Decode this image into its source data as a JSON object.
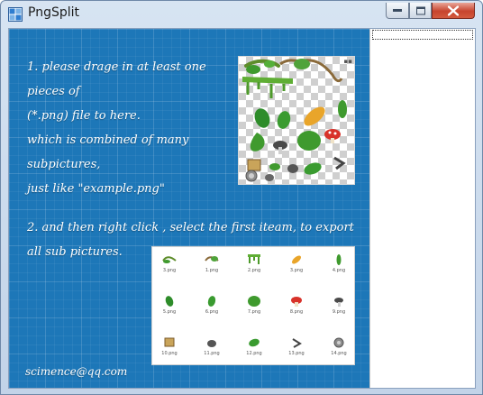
{
  "window": {
    "title": "PngSplit"
  },
  "instructions": {
    "step1_lines": [
      "1.  please drage in at least one pieces of",
      "(*.png) file to here.",
      "which is combined of many subpictures,",
      "just like \"example.png\""
    ],
    "step2_lines": [
      "2. and then right click , select the first iteam, to export",
      "all sub pictures."
    ],
    "email": "scimence@qq.com"
  },
  "exported_files": [
    "3.png",
    "1.png",
    "2.png",
    "3.png",
    "4.png",
    "5.png",
    "6.png",
    "7.png",
    "8.png",
    "9.png",
    "10.png",
    "11.png",
    "12.png",
    "13.png",
    "14.png"
  ],
  "colors": {
    "canvas_blue": "#1d77b8",
    "leaf_green": "#3f9a2e",
    "mushroom_red": "#d8322a",
    "leaf_orange": "#e8a52a"
  }
}
